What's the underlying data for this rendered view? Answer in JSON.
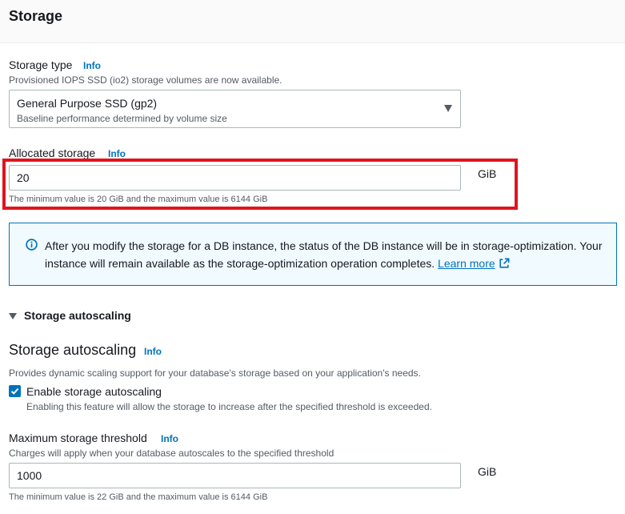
{
  "header": {
    "title": "Storage"
  },
  "storage_type": {
    "label": "Storage type",
    "info": "Info",
    "description": "Provisioned IOPS SSD (io2) storage volumes are now available.",
    "selected_value": "General Purpose SSD (gp2)",
    "selected_description": "Baseline performance determined by volume size"
  },
  "allocated_storage": {
    "label": "Allocated storage",
    "info": "Info",
    "value": "20",
    "unit": "GiB",
    "constraint": "The minimum value is 20 GiB and the maximum value is 6144 GiB"
  },
  "alert": {
    "text": "After you modify the storage for a DB instance, the status of the DB instance will be in storage-optimization. Your instance will remain available as the storage-optimization operation completes.",
    "link_label": "Learn more",
    "icon": "info-circle-icon",
    "color": "#0073bb"
  },
  "autoscaling": {
    "expander_label": "Storage autoscaling",
    "section_title": "Storage autoscaling",
    "info": "Info",
    "description": "Provides dynamic scaling support for your database's storage based on your application's needs.",
    "checkbox_label": "Enable storage autoscaling",
    "checkbox_checked": true,
    "checkbox_description": "Enabling this feature will allow the storage to increase after the specified threshold is exceeded."
  },
  "max_threshold": {
    "label": "Maximum storage threshold",
    "info": "Info",
    "description": "Charges will apply when your database autoscales to the specified threshold",
    "value": "1000",
    "unit": "GiB",
    "constraint": "The minimum value is 22 GiB and the maximum value is 6144 GiB"
  },
  "colors": {
    "accent": "#0073bb",
    "highlight": "#e0141e"
  }
}
